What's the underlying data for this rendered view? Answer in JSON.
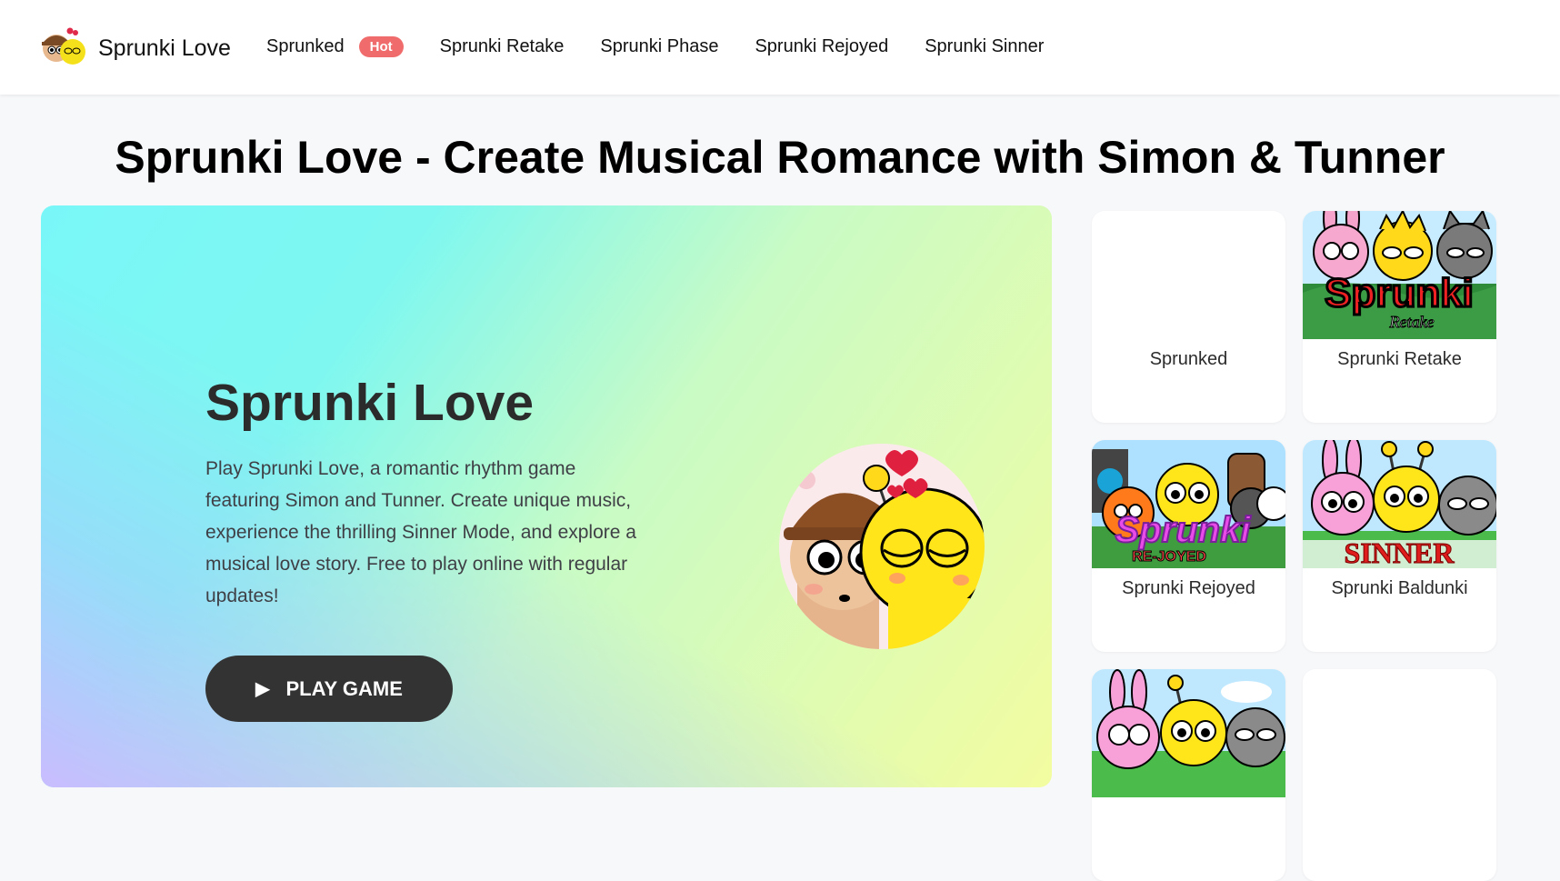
{
  "header": {
    "logo_text": "Sprunki Love",
    "logo_icon": "sprunki-characters-logo",
    "nav": [
      {
        "label": "Sprunked",
        "badge": "Hot"
      },
      {
        "label": "Sprunki Retake"
      },
      {
        "label": "Sprunki Phase"
      },
      {
        "label": "Sprunki Rejoyed"
      },
      {
        "label": "Sprunki Sinner"
      }
    ]
  },
  "page_title": "Sprunki Love - Create Musical Romance with Simon & Tunner",
  "hero": {
    "title": "Sprunki Love",
    "description": "Play Sprunki Love, a romantic rhythm game featuring Simon and Tunner. Create unique music, experience the thrilling Sinner Mode, and explore a musical love story. Free to play online with regular updates!",
    "play_label": "PLAY GAME",
    "play_icon": "play-icon"
  },
  "cards": [
    {
      "label": "Sprunked"
    },
    {
      "label": "Sprunki Retake",
      "thumb_title": "Sprunki",
      "thumb_subtitle": "Retake"
    },
    {
      "label": "Sprunki Rejoyed",
      "thumb_title": "Sprunki",
      "thumb_subtitle": "RE-JOYED"
    },
    {
      "label": "Sprunki Baldunki",
      "thumb_title": "SINNER"
    },
    {
      "label": ""
    },
    {
      "label": ""
    }
  ],
  "colors": {
    "hot_badge": "#f06b6b",
    "play_button": "#333333"
  }
}
